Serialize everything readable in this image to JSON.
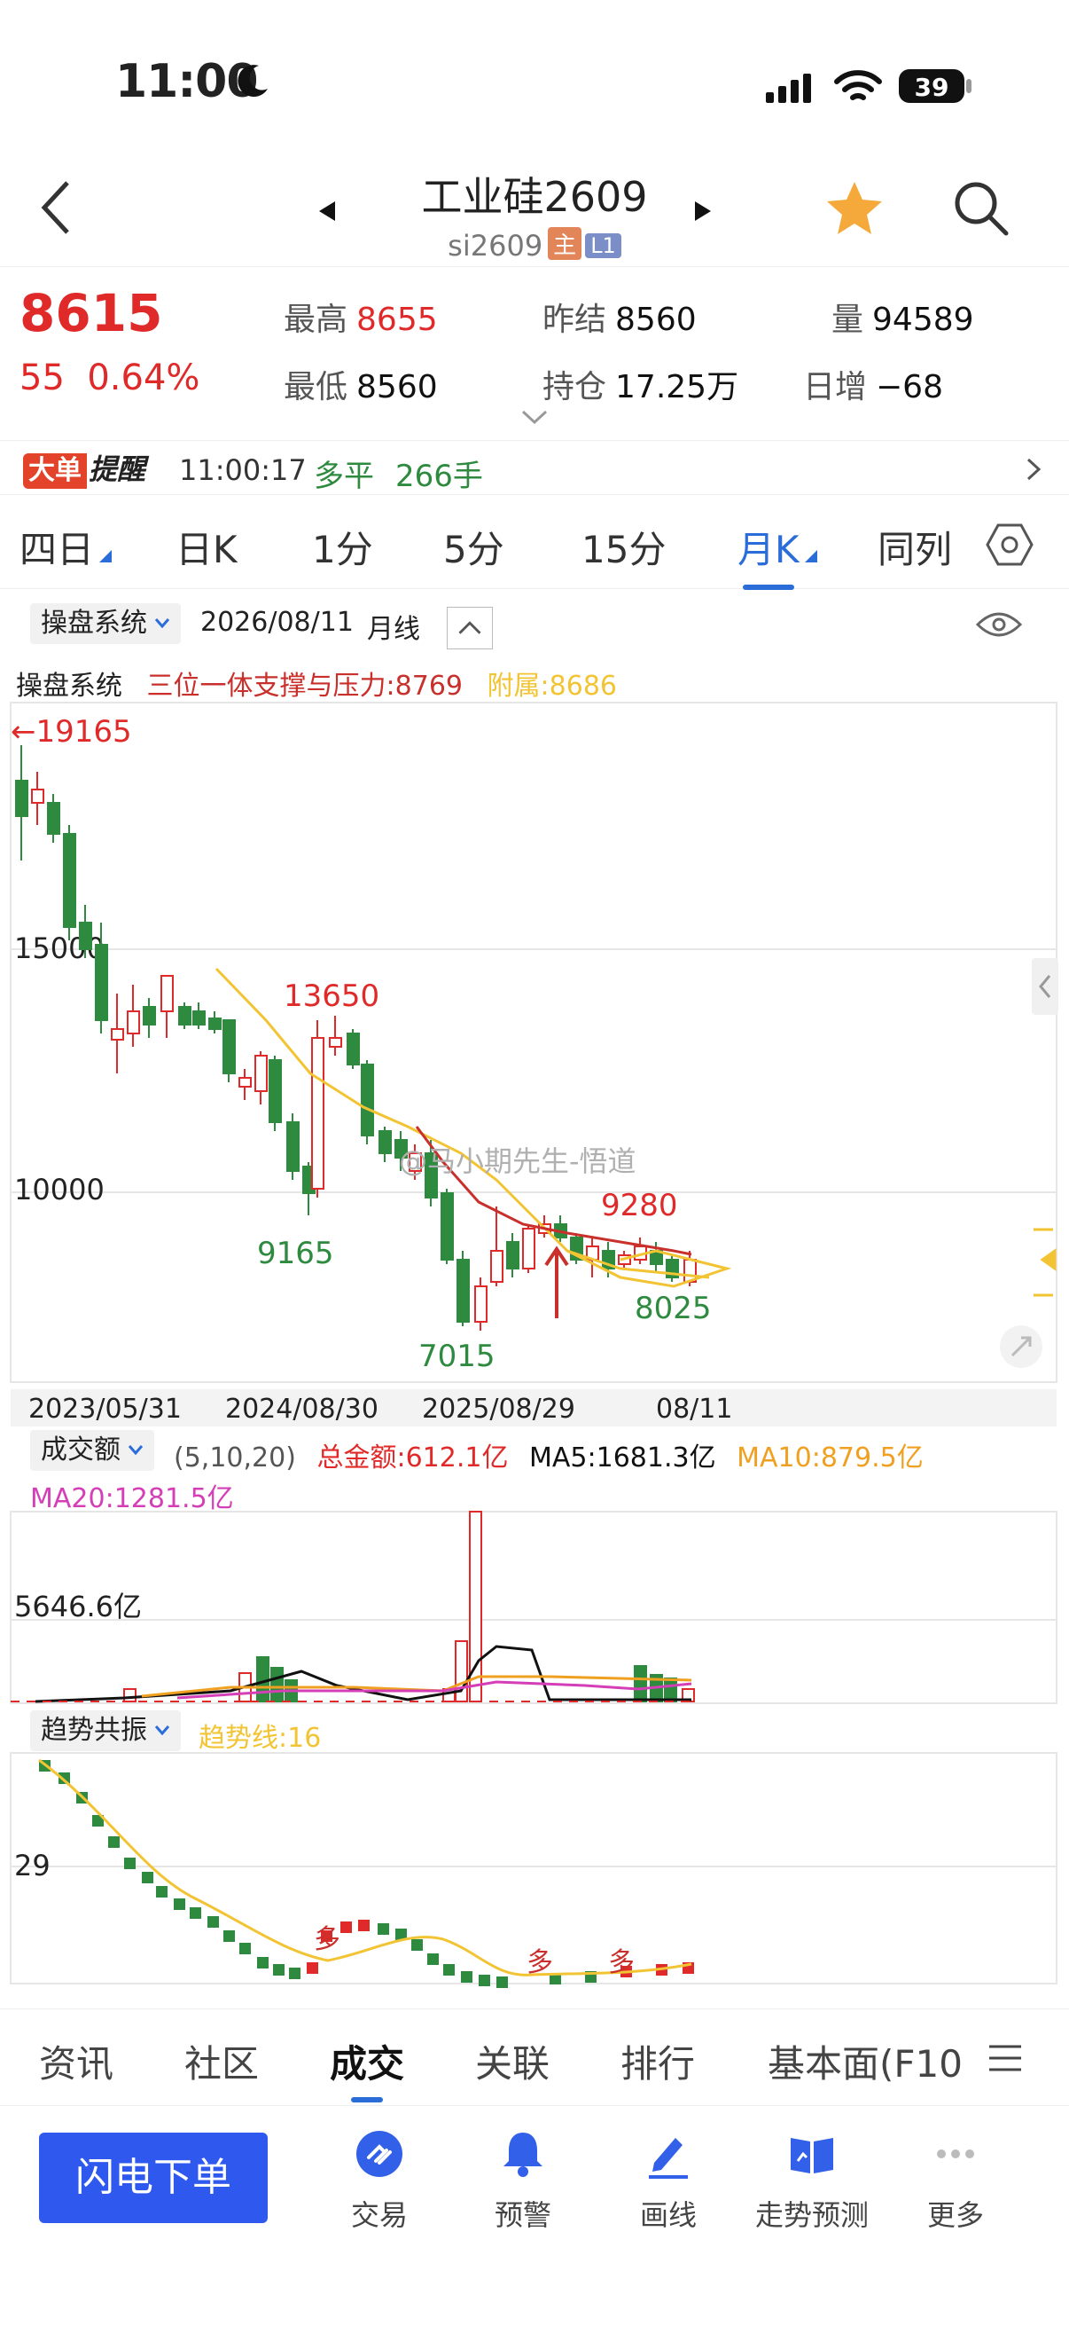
{
  "status": {
    "time": "11:00",
    "battery": "39"
  },
  "nav": {
    "title": "工业硅2609",
    "code": "si2609",
    "tag_main": "主",
    "tag_level": "L1"
  },
  "quote": {
    "price": "8615",
    "change": "55",
    "change_pct": "0.64%",
    "high_label": "最高",
    "high": "8655",
    "low_label": "最低",
    "low": "8560",
    "prev_settle_label": "昨结",
    "prev_settle": "8560",
    "open_int_label": "持仓",
    "open_int": "17.25万",
    "volume_label": "量",
    "volume": "94589",
    "daily_inc_label": "日增",
    "daily_inc": "−68"
  },
  "alert": {
    "badge_a": "大单",
    "badge_b": "提醒",
    "time": "11:00:17",
    "direction": "多平",
    "lots": "266手"
  },
  "period_tabs": [
    "四日",
    "日K",
    "1分",
    "5分",
    "15分",
    "月K",
    "同列"
  ],
  "active_period": "月K",
  "indicator_bar": {
    "system": "操盘系统",
    "date": "2026/08/11",
    "period": "月线"
  },
  "legend": {
    "system": "操盘系统",
    "main": "三位一体支撑与压力:8769",
    "aux": "附属:8686"
  },
  "main_chart": {
    "top_marker": "←19165",
    "y_labels": [
      "15000",
      "10000"
    ],
    "annotations": {
      "high1": "13650",
      "low1": "9165",
      "low2": "7015",
      "high2": "9280",
      "low3": "8025"
    },
    "x_labels": [
      "2023/05/31",
      "2024/08/30",
      "2025/08/29",
      "08/11"
    ],
    "watermark": "@马小期先生-悟道",
    "colors": {
      "up": "#e02a2a",
      "down": "#2d8a3e",
      "ma_yellow": "#f2c433",
      "ma_red": "#c9302c"
    }
  },
  "volume_panel": {
    "chip": "成交额",
    "params": "(5,10,20)",
    "total": "总金额:612.1亿",
    "ma5": "MA5:1681.3亿",
    "ma10": "MA10:879.5亿",
    "ma20": "MA20:1281.5亿",
    "y_label": "5646.6亿"
  },
  "trend_panel": {
    "chip": "趋势共振",
    "line": "趋势线:16",
    "y_label": "29",
    "marks": [
      "多",
      "多",
      "多"
    ]
  },
  "bottom_tabs": [
    "资讯",
    "社区",
    "成交",
    "关联",
    "排行",
    "基本面(F10"
  ],
  "active_bottom_tab": "成交",
  "toolbar": {
    "order_button": "闪电下单",
    "items": [
      {
        "label": "交易",
        "icon": "trade-icon"
      },
      {
        "label": "预警",
        "icon": "bell-icon"
      },
      {
        "label": "画线",
        "icon": "pen-icon"
      },
      {
        "label": "走势预测",
        "icon": "book-icon"
      },
      {
        "label": "更多",
        "icon": "more-icon"
      }
    ]
  }
}
